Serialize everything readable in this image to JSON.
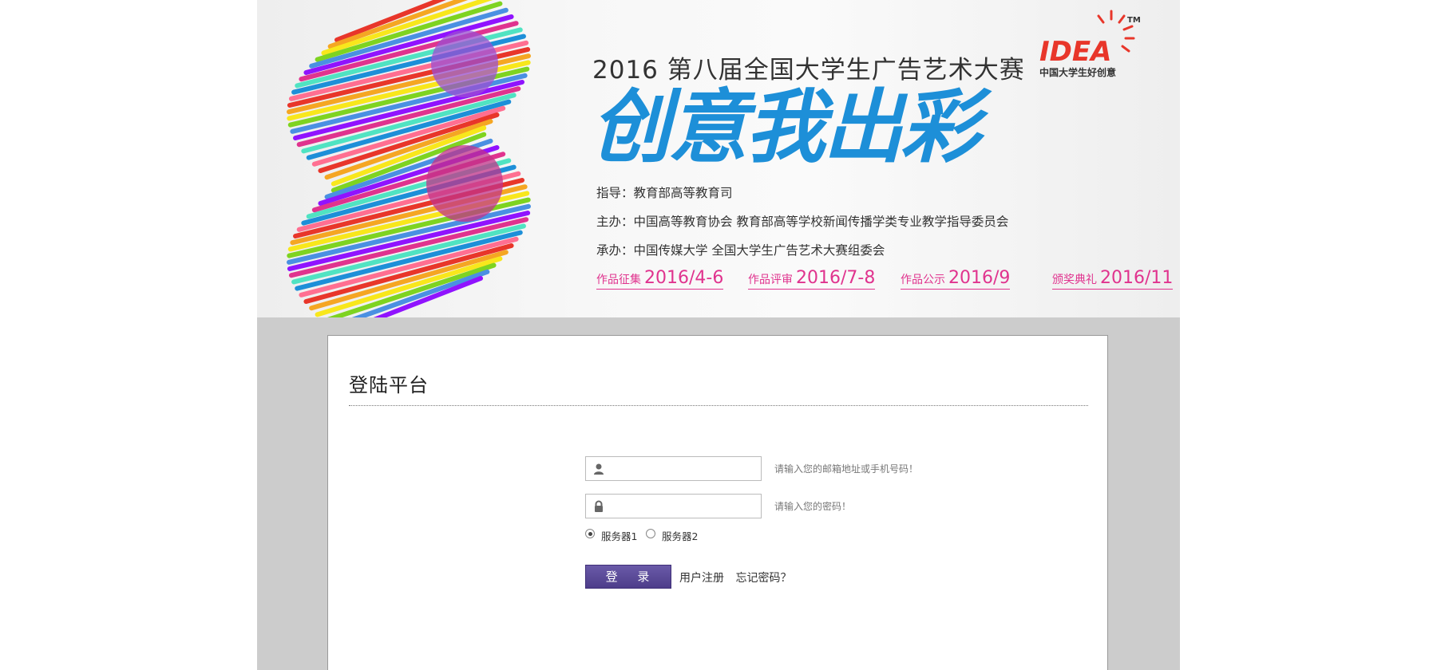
{
  "banner": {
    "headline": "2016 第八届全国大学生广告艺术大赛",
    "slogan": "创意我出彩",
    "guide": "指导：教育部高等教育司",
    "host": "主办：中国高等教育协会  教育部高等学校新闻传播学类专业教学指导委员会",
    "organizer": "承办：中国传媒大学  全国大学生广告艺术大赛组委会",
    "dates": [
      {
        "label": "作品征集",
        "value": "2016/4-6"
      },
      {
        "label": "作品评审",
        "value": "2016/7-8"
      },
      {
        "label": "作品公示",
        "value": "2016/9"
      },
      {
        "label": "颁奖典礼",
        "value": "2016/11"
      }
    ],
    "logo_text": "IDEA",
    "logo_tm": "TM",
    "logo_subtitle": "中国大学生好创意",
    "accent_blue": "#1d8fd8",
    "accent_pink": "#e0338e"
  },
  "login": {
    "title": "登陆平台",
    "username_hint": "请输入您的邮箱地址或手机号码！",
    "password_hint": "请输入您的密码！",
    "username_value": "",
    "password_value": "",
    "servers": [
      {
        "label": "服务器1",
        "checked": true
      },
      {
        "label": "服务器2",
        "checked": false
      }
    ],
    "submit_label": "登 录",
    "register_link": "用户注册",
    "forgot_link": "忘记密码？",
    "button_color": "#5a4a9a"
  }
}
